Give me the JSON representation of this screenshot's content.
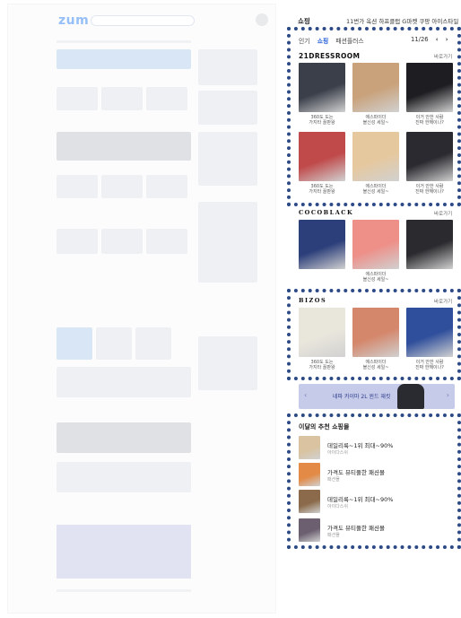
{
  "background_page": {
    "logo": "zum"
  },
  "panel": {
    "title": "쇼핑",
    "ticker": "11번가 옥션 하프클럽 G마켓 쿠팡 아이스타일"
  },
  "tabs": [
    {
      "label": "인기"
    },
    {
      "label": "쇼핑"
    },
    {
      "label": "패션플러스"
    }
  ],
  "pager": {
    "text": "11/26",
    "prev": "‹",
    "next": "›"
  },
  "sections": [
    {
      "brand": "21DRESSROOM",
      "more": "바로가기",
      "products": [
        {
          "caption_1": "360도 도는",
          "caption_2": "가지타 꿀판왕",
          "color": "#3a3f4a"
        },
        {
          "caption_1": "에스파이더",
          "caption_2": "블신성 세일~",
          "color": "#c9a27c"
        },
        {
          "caption_1": "이거 안한 사람",
          "caption_2": "진짜 한해이나?",
          "color": "#1e1e22"
        },
        {
          "caption_1": "360도 도는",
          "caption_2": "가지타 꿀판왕",
          "color": "#c0494a"
        },
        {
          "caption_1": "에스파이더",
          "caption_2": "블신성 세일~",
          "color": "#e6c89e"
        },
        {
          "caption_1": "이거 안한 사람",
          "caption_2": "진짜 한해이나?",
          "color": "#2a2a30"
        }
      ]
    },
    {
      "brand": "COCOBLACK",
      "more": "바로가기",
      "products": [
        {
          "caption_1": "",
          "caption_2": "",
          "color": "#2c3f7a"
        },
        {
          "caption_1": "에스파이더",
          "caption_2": "블신성 세일~",
          "color": "#ee8f88"
        },
        {
          "caption_1": "",
          "caption_2": "",
          "color": "#2b2b2f"
        }
      ]
    },
    {
      "brand": "BIZOS",
      "more": "바로가기",
      "products": [
        {
          "caption_1": "360도 도는",
          "caption_2": "가지타 꿀판왕",
          "color": "#e9e6dc"
        },
        {
          "caption_1": "에스파이더",
          "caption_2": "블신성 세일~",
          "color": "#d4876b"
        },
        {
          "caption_1": "이거 안한 사람",
          "caption_2": "진짜 한해이나?",
          "color": "#2f4f9c"
        }
      ]
    }
  ],
  "banner": {
    "text": "네파 카이마 2L 윈드 재킷"
  },
  "recommended": {
    "title": "이달의 추천 쇼핑몰",
    "items": [
      {
        "name": "데일리룩~1위 최대~90%",
        "seller": "아이다스쉬",
        "color": "#d9c3a0"
      },
      {
        "name": "가격도 뷰티풀한 패션몰",
        "seller": "패션몰",
        "color": "#e28a46"
      },
      {
        "name": "데일리룩~1위 최대~90%",
        "seller": "아이다스쉬",
        "color": "#8a6a4a"
      },
      {
        "name": "가격도 뷰티풀한 패션몰",
        "seller": "패션몰",
        "color": "#6b5f70"
      }
    ]
  }
}
